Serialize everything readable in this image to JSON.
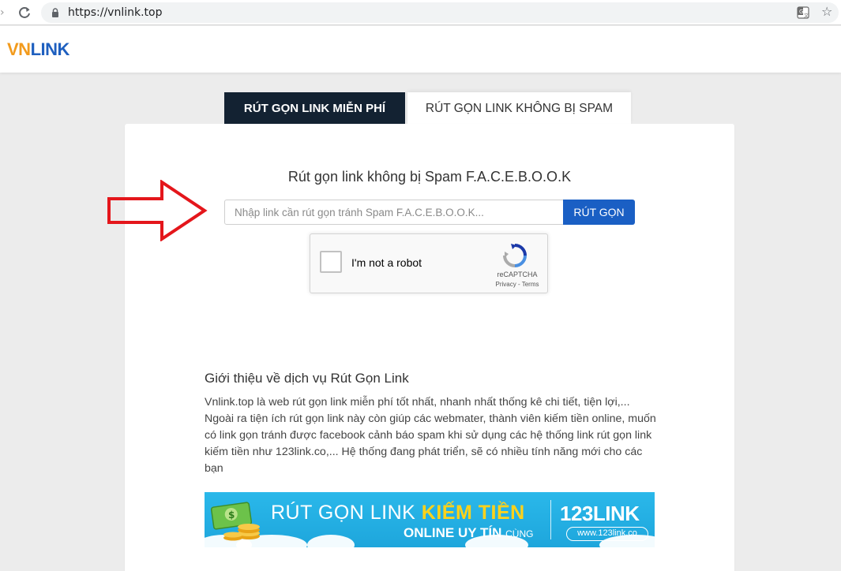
{
  "browser": {
    "url": "https://vnlink.top",
    "forward_icon": "chevron-right-icon",
    "reload_icon": "reload-icon",
    "lock_icon": "lock-icon",
    "translate_icon": "translate-icon",
    "bookmark_icon": "star-icon"
  },
  "header": {
    "logo_part1": "VN",
    "logo_part2": "LINK",
    "logo_colors": {
      "vn": "#f29b1d",
      "link": "#1e5fbf"
    }
  },
  "tabs": [
    {
      "label": "RÚT GỌN LINK MIỄN PHÍ",
      "active": true
    },
    {
      "label": "RÚT GỌN LINK KHÔNG BỊ SPAM",
      "active": false
    }
  ],
  "form": {
    "title": "Rút gọn link không bị Spam F.A.C.E.B.O.O.K",
    "input_placeholder": "Nhập link cần rút gọn tránh Spam F.A.C.E.B.O.O.K...",
    "input_value": "",
    "submit_label": "RÚT GỌN"
  },
  "captcha": {
    "label": "I'm not a robot",
    "brand": "reCAPTCHA",
    "links": "Privacy - Terms"
  },
  "intro": {
    "title": "Giới thiệu về dịch vụ Rút Gọn Link",
    "body": "Vnlink.top là web rút gọn link miễn phí tốt nhất, nhanh nhất thống kê chi tiết, tiện lợi,... Ngoài ra tiện ích rút gọn link này còn giúp các webmater, thành viên kiếm tiền online, muốn có link gọn tránh được facebook cảnh báo spam khi sử dụng các hệ thống link rút gọn link kiếm tiền như 123link.co,... Hệ thống đang phát triển, sẽ có nhiều tính năng mới cho các bạn"
  },
  "banner": {
    "line1_prefix": "RÚT GỌN LINK ",
    "line1_highlight": "KIẾM TIỀN",
    "line2_main": "ONLINE UY TÍN",
    "line2_small": "CÙNG",
    "brand": "123LINK",
    "url": "www.123link.co",
    "colors": {
      "background": "#1ea6dc",
      "highlight": "#ffd21a"
    }
  },
  "colors": {
    "active_tab": "#132232",
    "primary_button": "#1a5fc4",
    "annotation_arrow": "#e4161b"
  }
}
